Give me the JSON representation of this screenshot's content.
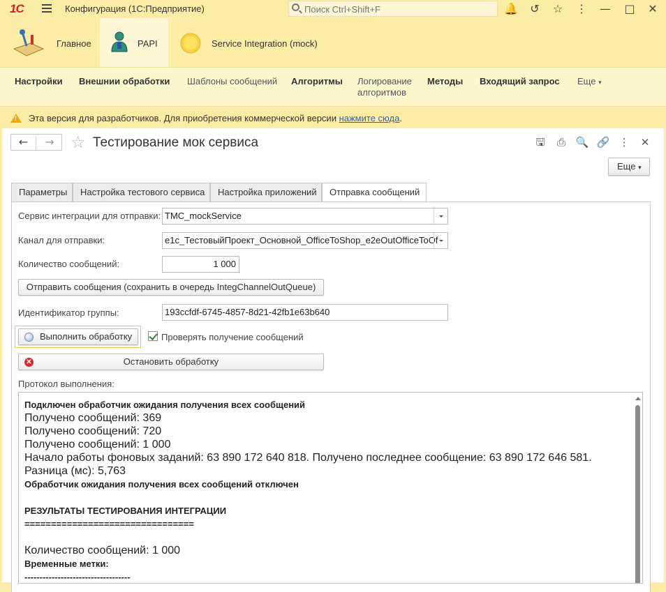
{
  "titlebar": {
    "logo": "1С",
    "title": "Конфигурация  (1С:Предприятие)",
    "search_placeholder": "Поиск Ctrl+Shift+F"
  },
  "sections": [
    {
      "label": "Главное",
      "icon": "desk-lamp-icon"
    },
    {
      "label": "PAPI",
      "icon": "person-icon"
    },
    {
      "label": "Service Integration (mock)",
      "icon": "sun-circle-icon"
    }
  ],
  "commands": {
    "settings": "Настройки",
    "external": "Внешнии обработки",
    "templates": "Шаблоны сообщений",
    "algorithms": "Алгоритмы",
    "logging_line1": "Логирование",
    "logging_line2": "алгоритмов",
    "methods": "Методы",
    "incoming": "Входящий запрос",
    "more": "Еще"
  },
  "warning": {
    "text": "Эта версия для разработчиков. Для приобретения коммерческой версии ",
    "link": "нажмите сюда",
    "tail": "."
  },
  "form": {
    "title": "Тестирование мок сервиса",
    "more_button": "Еще",
    "tabs": [
      "Параметры",
      "Настройка тестового сервиса",
      "Настройка приложений",
      "Отправка сообщений"
    ],
    "service_label": "Сервис интеграции для отправки:",
    "service_value": "TMC_mockService",
    "channel_label": "Канал для отправки:",
    "channel_value": "e1c_ТестовыйПроект_Основной_OfficeToShop_e2eOutOfficeToOf",
    "count_label": "Количество сообщений:",
    "count_value": "1 000",
    "send_button": "Отправить сообщения (сохранить в очередь IntegChannelOutQueue)",
    "group_label": "Идентификатор группы:",
    "group_value": "193ccfdf-6745-4857-8d21-42fb1e63b640",
    "run_button": "Выполнить обработку",
    "check_label": "Проверять получение сообщений",
    "check_checked": true,
    "stop_button": "Остановить обработку",
    "protocol_label": "Протокол выполнения:"
  },
  "log": [
    {
      "text": "Подключен обработчик ожидания получения всех сообщений",
      "style": "bold"
    },
    {
      "text": "Получено сообщений: 369",
      "style": "big"
    },
    {
      "text": "Получено сообщений: 720",
      "style": "big"
    },
    {
      "text": "Получено сообщений: 1 000",
      "style": "big"
    },
    {
      "text": "Начало работы фоновых заданий: 63 890 172 640 818. Получено последнее сообщение: 63 890 172 646 581.",
      "style": "big"
    },
    {
      "text": "Разница (мс): 5,763",
      "style": "big"
    },
    {
      "text": "Обработчик ожидания получения всех сообщений отключен",
      "style": "bold"
    },
    {
      "text": "",
      "style": "sp"
    },
    {
      "text": "РЕЗУЛЬТАТЫ ТЕСТИРОВАНИЯ ИНТЕГРАЦИИ",
      "style": "bold"
    },
    {
      "text": "================================",
      "style": "bold"
    },
    {
      "text": "",
      "style": "sp"
    },
    {
      "text": "Количество сообщений: 1 000",
      "style": "big"
    },
    {
      "text": "Временные метки:",
      "style": "bold"
    },
    {
      "text": "-----------------------------------",
      "style": "bold"
    }
  ],
  "colors": {
    "titlebar_bg": "#fbeda6",
    "accent_red": "#d0202a",
    "link": "#3b5fa7",
    "warning_icon": "#f0a800"
  }
}
